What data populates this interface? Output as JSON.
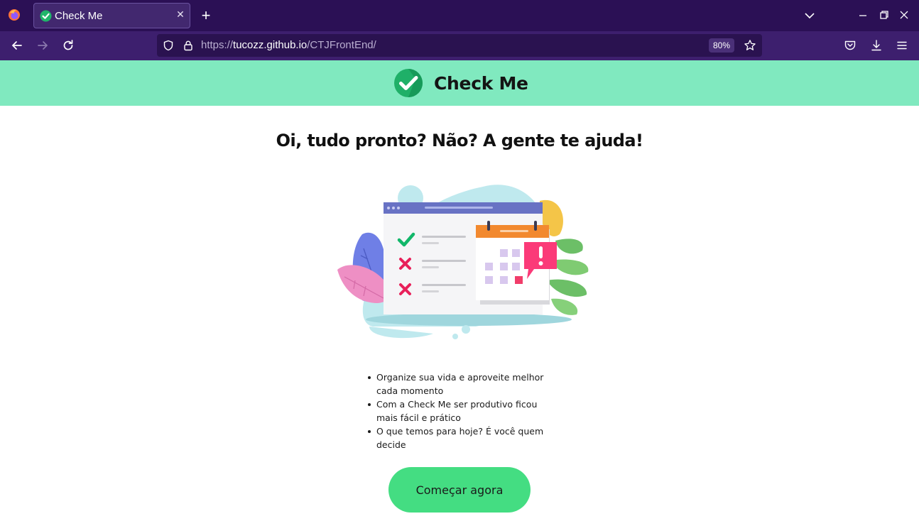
{
  "browser": {
    "tab": {
      "title": "Check Me",
      "favicon": "check-circle-icon"
    },
    "url": {
      "prefix": "https://",
      "host": "tucozz.github.io",
      "path": "/CTJFrontEnd/"
    },
    "zoom": "80%",
    "colors": {
      "tabbar": "#2b1055",
      "navbar": "#3d1f6e",
      "urlbar": "#2a1250"
    }
  },
  "header": {
    "brand_name": "Check Me",
    "logo_icon": "check-circle-icon",
    "background": "#80e9bf"
  },
  "hero": {
    "title": "Oi, tudo pronto? Não? A gente te ajuda!",
    "illustration_icon": "task-checklist-calendar-illustration"
  },
  "features": [
    "Organize sua vida e aproveite melhor cada momento",
    "Com a Check Me ser produtivo ficou mais fácil e prático",
    "O que temos para hoje? É você quem decide"
  ],
  "cta": {
    "label": "Começar agora",
    "color": "#44dd82"
  }
}
